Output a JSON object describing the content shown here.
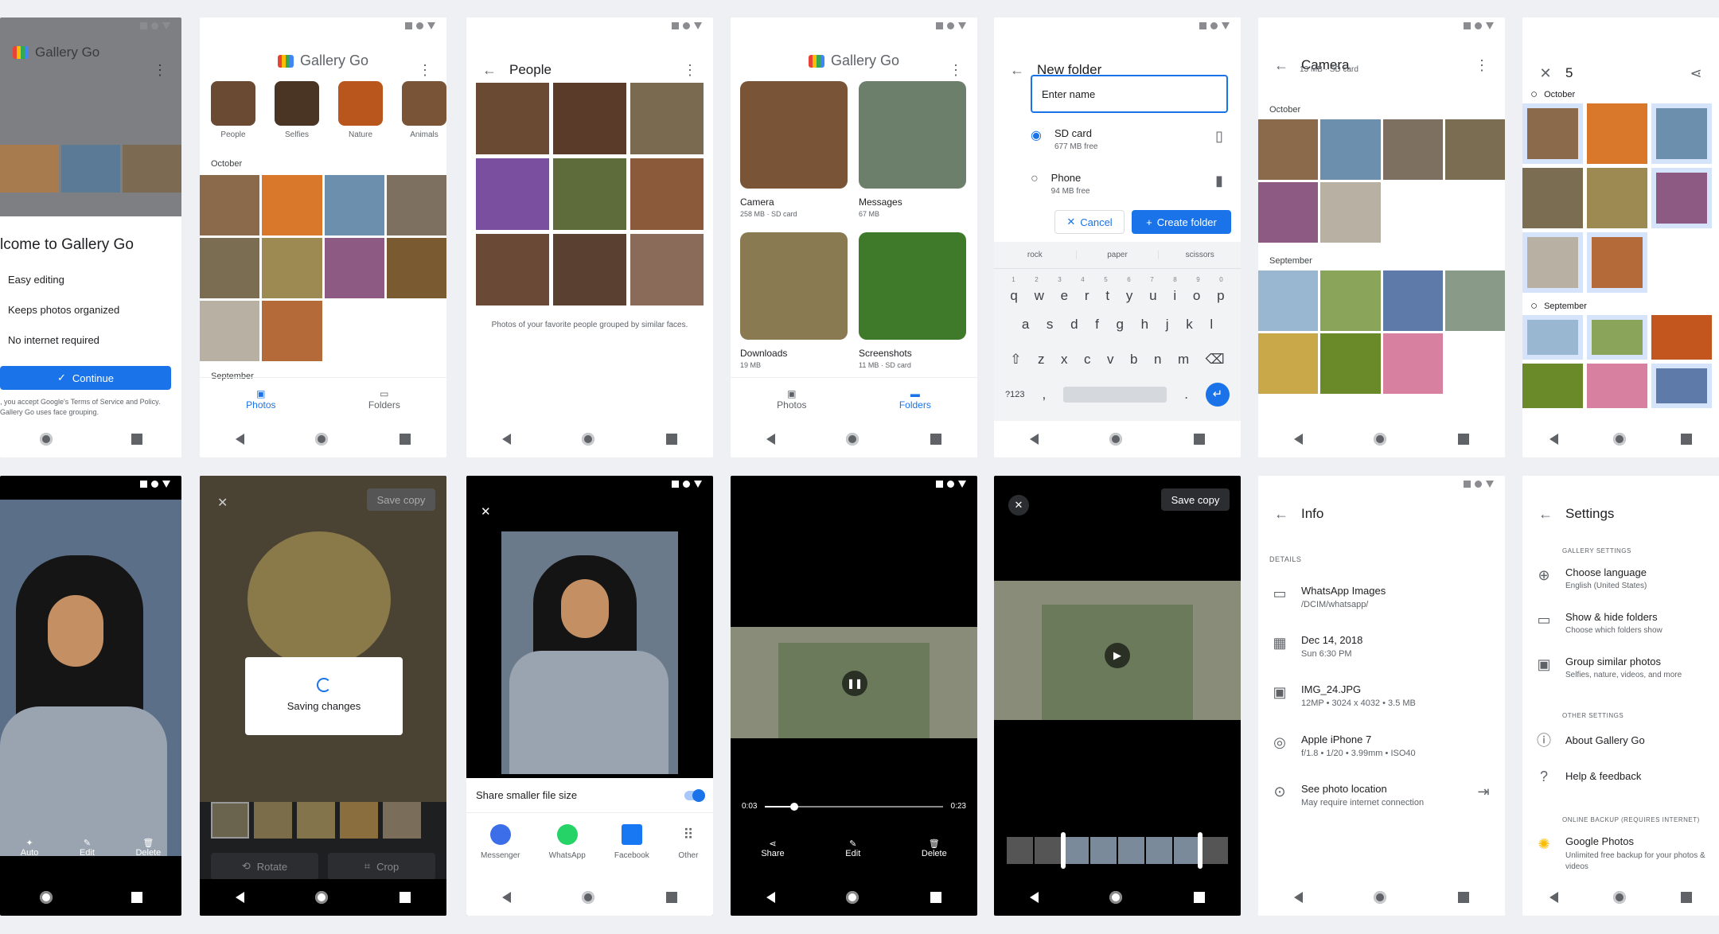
{
  "colors": {
    "accent": "#1a73e8",
    "bg": "#eef0f4",
    "dark": "#000000"
  },
  "s1": {
    "title": "Gallery Go",
    "welcome": "lcome to Gallery Go",
    "features": [
      "Easy editing",
      "Keeps photos organized",
      "No internet required"
    ],
    "continue": "Continue",
    "legal": ", you accept Google's Terms of Service and Policy. Gallery Go uses face grouping."
  },
  "s2": {
    "title": "Gallery Go",
    "chips": [
      "People",
      "Selfies",
      "Nature",
      "Animals"
    ],
    "october": "October",
    "september": "September",
    "nav_photos": "Photos",
    "nav_folders": "Folders"
  },
  "s3": {
    "title": "People",
    "caption": "Photos of your favorite people grouped by similar faces."
  },
  "s4": {
    "title": "Gallery Go",
    "folders": [
      {
        "name": "Camera",
        "meta": "258 MB · SD card"
      },
      {
        "name": "Messages",
        "meta": "67 MB"
      },
      {
        "name": "Downloads",
        "meta": "19 MB"
      },
      {
        "name": "Screenshots",
        "meta": "11 MB · SD card"
      }
    ],
    "nav_photos": "Photos",
    "nav_folders": "Folders"
  },
  "s5": {
    "title": "New folder",
    "input": "Enter name",
    "opt1": "SD card",
    "opt1_sub": "677 MB free",
    "opt2": "Phone",
    "opt2_sub": "94 MB free",
    "cancel": "Cancel",
    "create": "Create folder",
    "suggest": [
      "rock",
      "paper",
      "scissors"
    ],
    "nums": [
      "1",
      "2",
      "3",
      "4",
      "5",
      "6",
      "7",
      "8",
      "9",
      "0"
    ],
    "row1": [
      "q",
      "w",
      "e",
      "r",
      "t",
      "y",
      "u",
      "i",
      "o",
      "p"
    ],
    "row2": [
      "a",
      "s",
      "d",
      "f",
      "g",
      "h",
      "j",
      "k",
      "l"
    ],
    "row3": [
      "z",
      "x",
      "c",
      "v",
      "b",
      "n",
      "m"
    ],
    "sym": "?123"
  },
  "s6": {
    "title": "Camera",
    "sub": "13 MB · SD card",
    "october": "October",
    "september": "September"
  },
  "s7": {
    "title": "5",
    "october": "October",
    "september": "September"
  },
  "s8": {
    "actions": [
      "Auto",
      "Edit",
      "Delete"
    ]
  },
  "s9": {
    "save": "Save copy",
    "saving": "Saving changes",
    "rotate": "Rotate",
    "crop": "Crop"
  },
  "s10": {
    "toggle": "Share smaller file size",
    "apps": [
      "Messenger",
      "WhatsApp",
      "Facebook",
      "Other"
    ]
  },
  "s11": {
    "start": "0:03",
    "end": "0:23",
    "actions": [
      "Share",
      "Edit",
      "Delete"
    ]
  },
  "s12": {
    "save": "Save copy"
  },
  "s13": {
    "title": "Info",
    "details": "DETAILS",
    "items": [
      {
        "t": "WhatsApp Images",
        "s": "/DCIM/whatsapp/"
      },
      {
        "t": "Dec 14, 2018",
        "s": "Sun 6:30 PM"
      },
      {
        "t": "IMG_24.JPG",
        "s": "12MP  •  3024 x 4032  •  3.5 MB"
      },
      {
        "t": "Apple iPhone 7",
        "s": "f/1.8  •  1/20  •  3.99mm  •  ISO40"
      },
      {
        "t": "See photo location",
        "s": "May require internet connection"
      }
    ]
  },
  "s14": {
    "title": "Settings",
    "gallery": "GALLERY SETTINGS",
    "other": "OTHER SETTINGS",
    "backup": "ONLINE BACKUP (REQUIRES INTERNET)",
    "items": [
      {
        "t": "Choose language",
        "s": "English (United States)"
      },
      {
        "t": "Show & hide folders",
        "s": "Choose which folders show"
      },
      {
        "t": "Group similar photos",
        "s": "Selfies, nature, videos, and more"
      },
      {
        "t": "About Gallery Go",
        "s": ""
      },
      {
        "t": "Help & feedback",
        "s": ""
      },
      {
        "t": "Google Photos",
        "s": "Unlimited free backup for your photos & videos"
      }
    ]
  }
}
